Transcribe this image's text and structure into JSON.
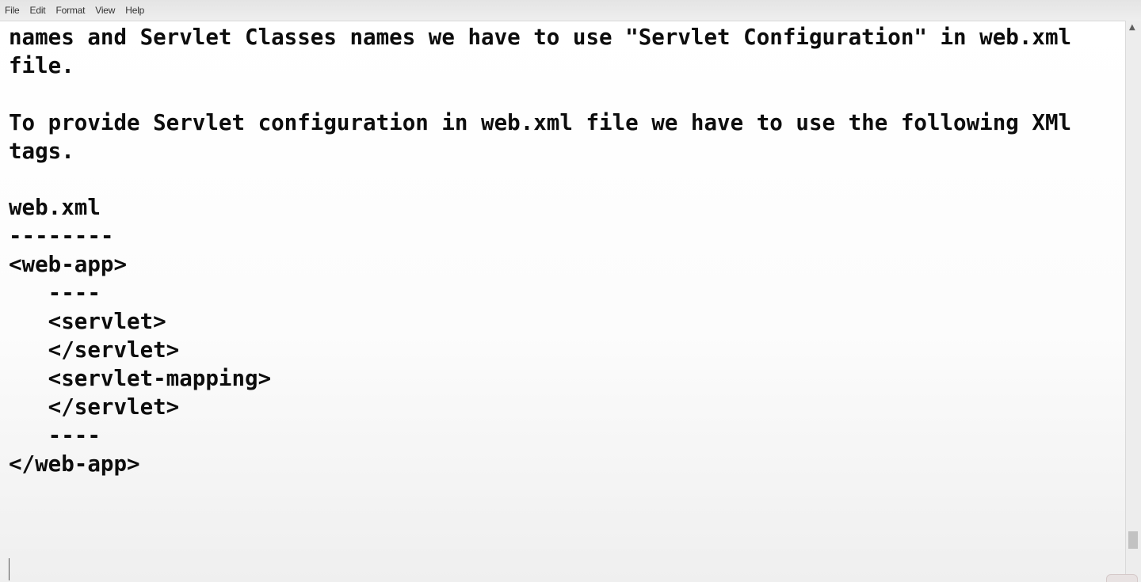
{
  "menu": {
    "file": "File",
    "edit": "Edit",
    "format": "Format",
    "view": "View",
    "help": "Help"
  },
  "editor": {
    "lines": [
      "names and Servlet Classes names we have to use \"Servlet Configuration\" in web.xml",
      "file.",
      "",
      "To provide Servlet configuration in web.xml file we have to use the following XMl",
      "tags.",
      "",
      "web.xml",
      "--------",
      "<web-app>",
      "   ----",
      "   <servlet>",
      "   </servlet>",
      "   <servlet-mapping>",
      "   </servlet>",
      "   ----",
      "</web-app>"
    ]
  },
  "scrollbar": {
    "up_arrow_icon": "chevron-up-icon"
  }
}
